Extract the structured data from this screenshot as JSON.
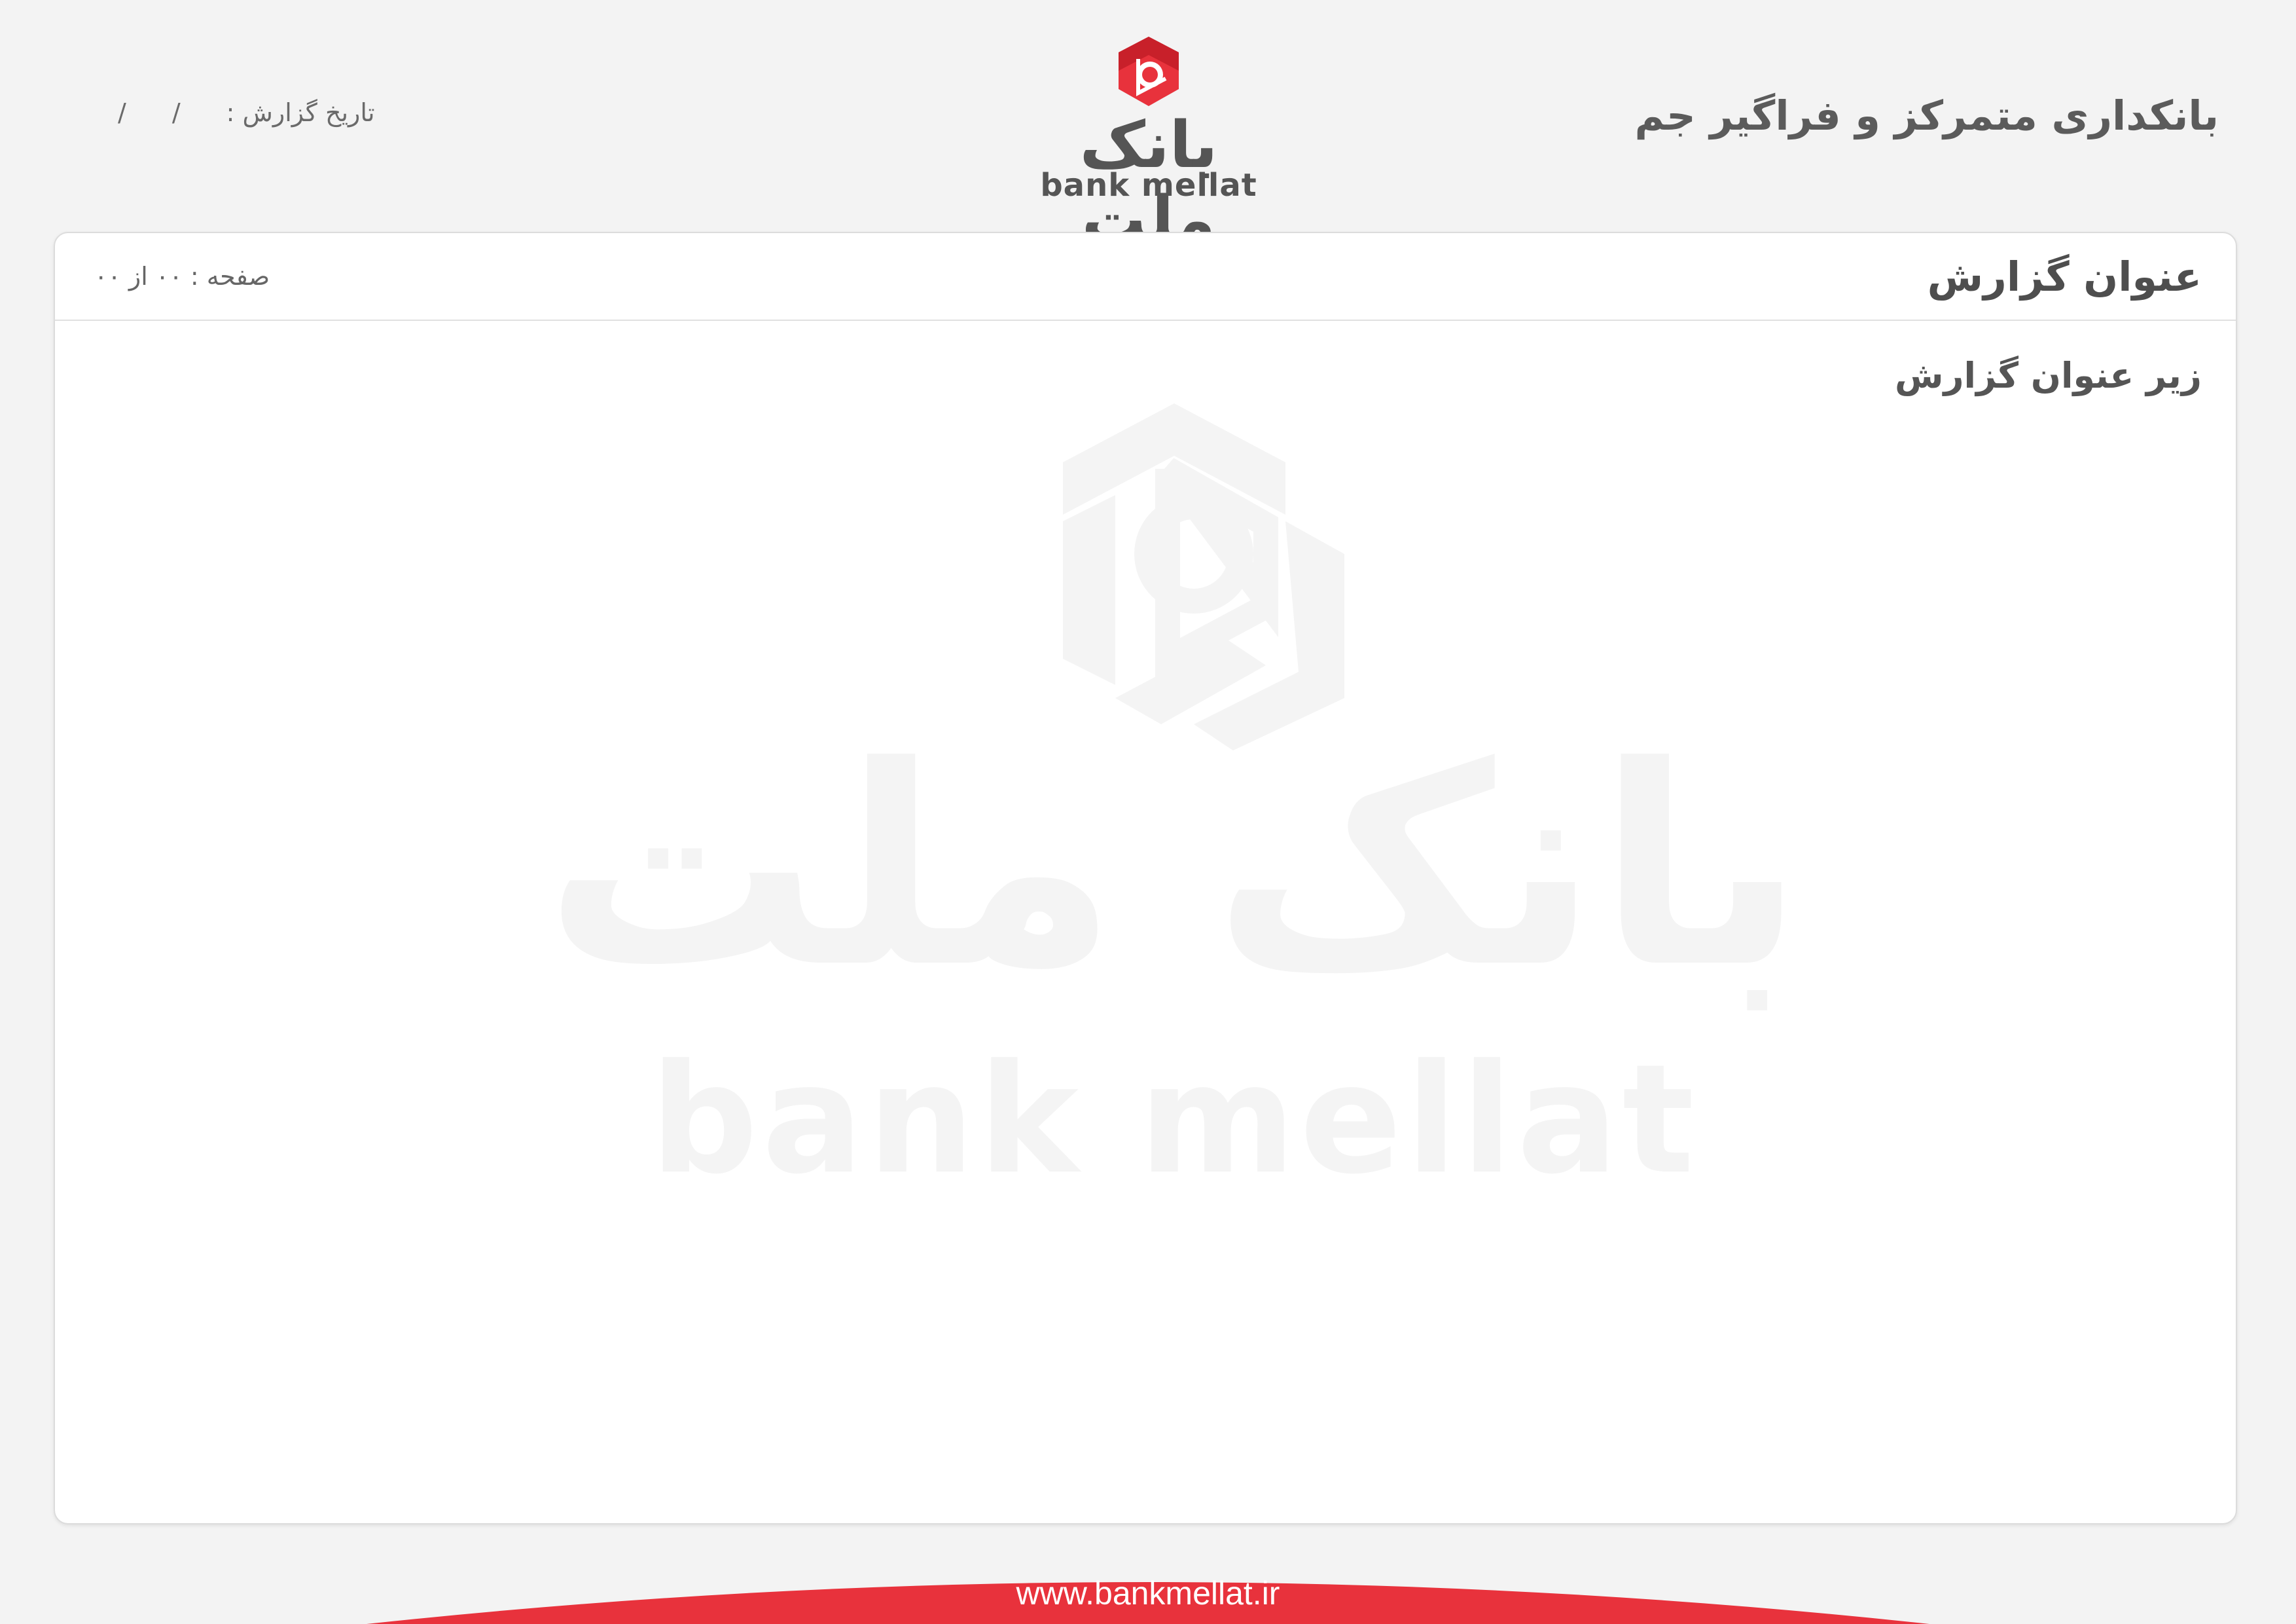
{
  "header": {
    "system_title": "بانکداری متمرکز و فراگیر جم",
    "report_date_label": "تاریخ گزارش :",
    "date_sep_1": "/",
    "date_sep_2": "/"
  },
  "logo": {
    "fa_text": "بانک ملت",
    "en_text": "bank mellat",
    "brand_color": "#e8323c"
  },
  "card": {
    "title": "عنوان گزارش",
    "page_info": "صفحه : ۰۰ از ۰۰",
    "subtitle": "زیر عنوان گزارش"
  },
  "watermark": {
    "fa_text": "بانک ملت",
    "en_text": "bank mellat"
  },
  "footer": {
    "url": "www.bankmellat.ir",
    "band_color": "#e8323c"
  }
}
